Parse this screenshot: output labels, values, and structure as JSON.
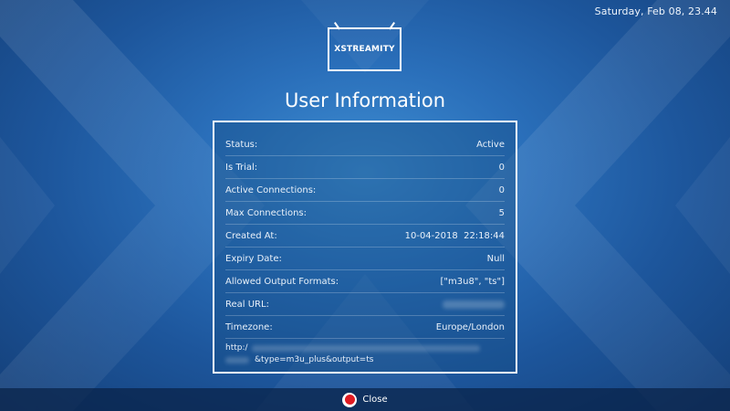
{
  "header": {
    "datetime": "Saturday, Feb 08, 23.44"
  },
  "logo": {
    "text": "XSTREAMITY"
  },
  "page": {
    "title": "User Information"
  },
  "user_info": {
    "rows": [
      {
        "label": "Status:",
        "value": "Active"
      },
      {
        "label": "Is Trial:",
        "value": "0"
      },
      {
        "label": "Active Connections:",
        "value": "0"
      },
      {
        "label": "Max Connections:",
        "value": "5"
      },
      {
        "label": "Created At:",
        "value": "10-04-2018  22:18:44"
      },
      {
        "label": "Expiry Date:",
        "value": "Null"
      },
      {
        "label": "Allowed Output Formats:",
        "value": "[\"m3u8\", \"ts\"]"
      },
      {
        "label": "Real URL:",
        "value": ""
      },
      {
        "label": "Timezone:",
        "value": "Europe/London"
      }
    ],
    "url_prefix": "http:/",
    "url_suffix": "&type=m3u_plus&output=ts"
  },
  "footer": {
    "close_label": "Close"
  },
  "colors": {
    "close_button_red": "#e01b22",
    "background_blue": "#2a6fba"
  }
}
